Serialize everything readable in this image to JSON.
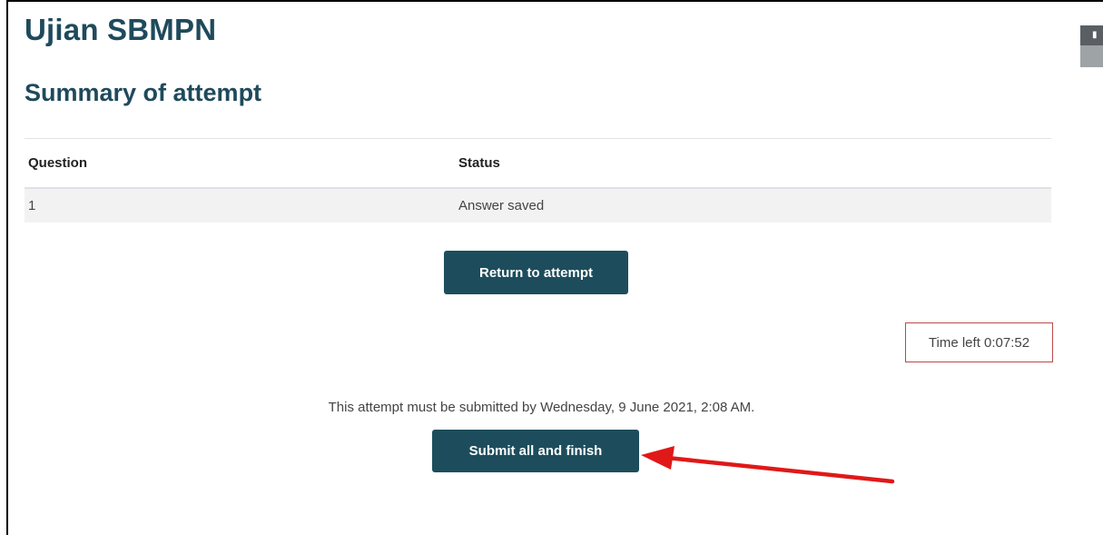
{
  "page": {
    "course_title": "Ujian SBMPN",
    "summary_title": "Summary of attempt"
  },
  "summary_table": {
    "headers": {
      "question": "Question",
      "status": "Status"
    },
    "rows": [
      {
        "question": "1",
        "status": "Answer saved"
      }
    ]
  },
  "actions": {
    "return_label": "Return to attempt",
    "submit_label": "Submit all and finish"
  },
  "timer": {
    "text": "Time left 0:07:52"
  },
  "deadline_text": "This attempt must be submitted by Wednesday, 9 June 2021, 2:08 AM.",
  "colors": {
    "heading": "#1f4a5c",
    "button_bg": "#1d4d5c",
    "timer_border": "#b84a4a",
    "annotation_arrow": "#e01818"
  },
  "annotation": {
    "icon": "red-arrow-icon"
  }
}
